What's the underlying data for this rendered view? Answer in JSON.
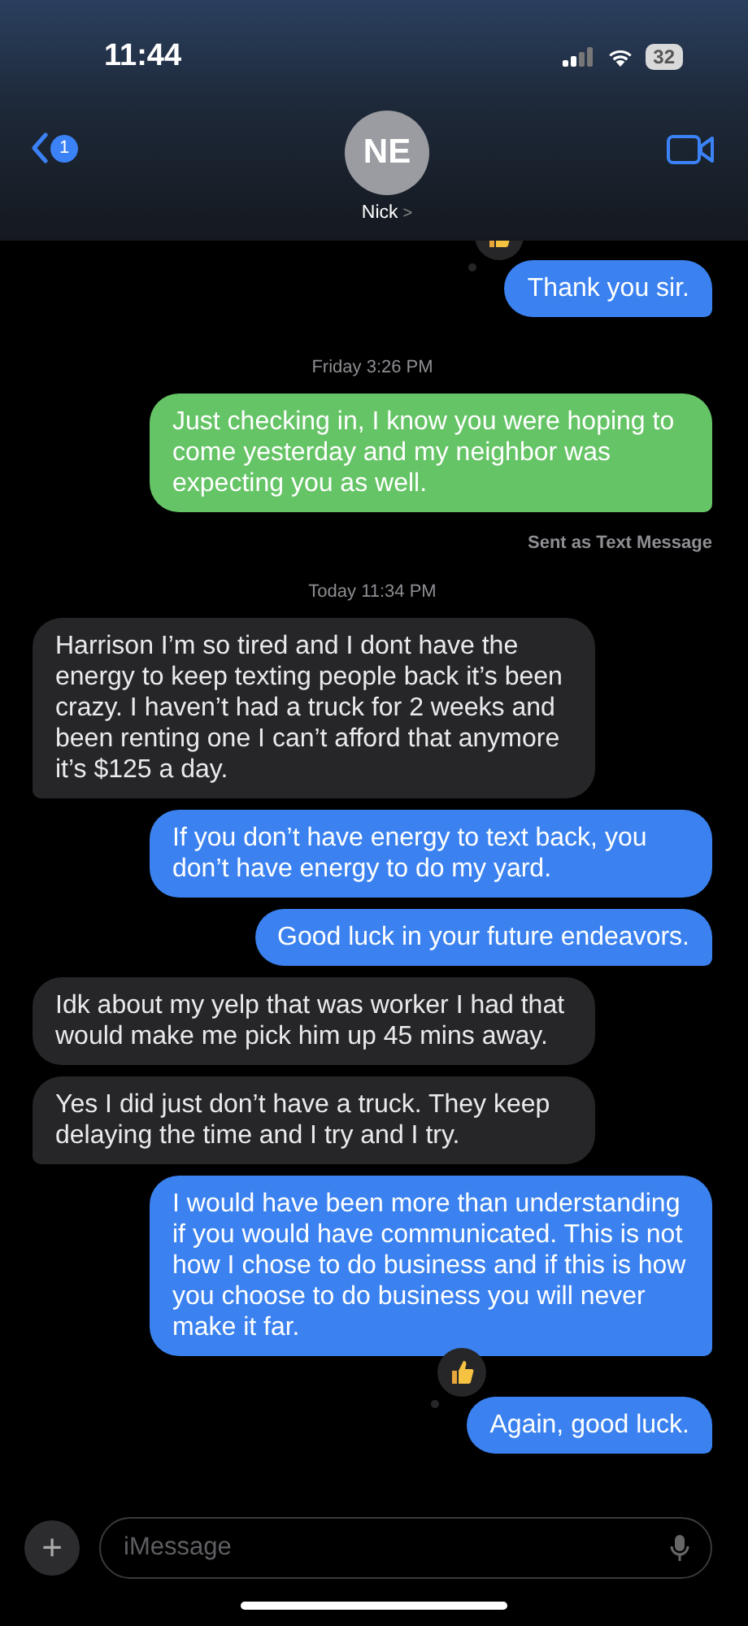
{
  "status_bar": {
    "time": "11:44",
    "battery": "32"
  },
  "header": {
    "back_badge": "1",
    "avatar_initials": "NE",
    "contact_name": "Nick",
    "chevron": ">"
  },
  "messages": [
    {
      "kind": "bubble",
      "outgoing": true,
      "color": "#3b82f0",
      "text": "Thank you sir.",
      "tail": true,
      "reaction": true
    },
    {
      "kind": "timestamp",
      "text": "Friday 3:26 PM"
    },
    {
      "kind": "bubble",
      "outgoing": true,
      "color": "#65c466",
      "text": "Just checking in, I know you were hoping to come yesterday and my neighbor was expecting you as well.",
      "tail": true,
      "reaction": false
    },
    {
      "kind": "note",
      "text": "Sent as Text Message"
    },
    {
      "kind": "timestamp",
      "text": "Today 11:34 PM"
    },
    {
      "kind": "bubble",
      "outgoing": false,
      "color": "#262628",
      "text": "Harrison I’m so tired and I dont have the energy to keep texting people back it’s been crazy. I haven’t had a truck for 2 weeks and been renting one I can’t afford that anymore it’s $125 a day.",
      "tail": true,
      "reaction": false
    },
    {
      "kind": "bubble",
      "outgoing": true,
      "color": "#3b82f0",
      "text": "If you don’t have energy to text back, you don’t have energy to do my yard.",
      "tail": false,
      "reaction": false
    },
    {
      "kind": "bubble",
      "outgoing": true,
      "color": "#3b82f0",
      "text": "Good luck in your future endeavors.",
      "tail": true,
      "reaction": false
    },
    {
      "kind": "bubble",
      "outgoing": false,
      "color": "#262628",
      "text": "Idk about my yelp that was worker I had that would make me pick him up 45 mins away.",
      "tail": false,
      "reaction": false
    },
    {
      "kind": "bubble",
      "outgoing": false,
      "color": "#262628",
      "text": "Yes I did just don’t have a truck. They keep delaying the time and I try and I try.",
      "tail": true,
      "reaction": false
    },
    {
      "kind": "bubble",
      "outgoing": true,
      "color": "#3b82f0",
      "text": "I would have been more than understanding if you would have communicated. This is not how I chose to do business and if this is how you choose to do business you will never make it far.",
      "tail": true,
      "reaction": false
    },
    {
      "kind": "bubble",
      "outgoing": true,
      "color": "#3b82f0",
      "text": "Again, good luck.",
      "tail": true,
      "reaction": true
    }
  ],
  "composer": {
    "placeholder": "iMessage",
    "plus": "+"
  }
}
